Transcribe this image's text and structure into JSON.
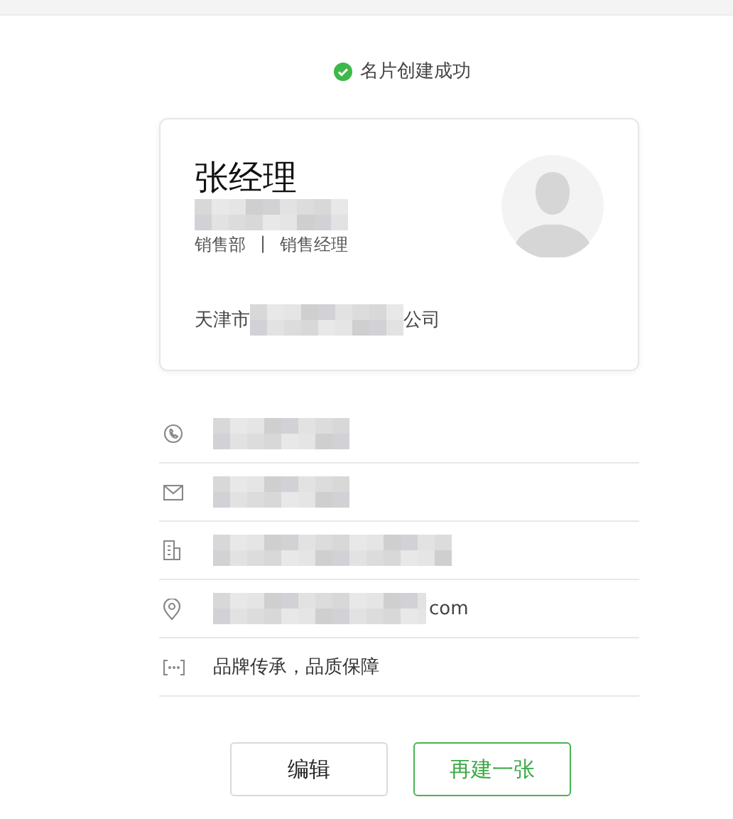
{
  "notice": {
    "text": "名片创建成功"
  },
  "card": {
    "name": "张经理",
    "name_line_redacted": true,
    "department": "销售部",
    "separator": "|",
    "title": "销售经理",
    "company_prefix": "天津市",
    "company_redacted": true,
    "company_suffix": "公司"
  },
  "rows": [
    {
      "kind": "phone",
      "redacted": true
    },
    {
      "kind": "email",
      "redacted": true
    },
    {
      "kind": "company",
      "redacted": true
    },
    {
      "kind": "address",
      "text": "com",
      "redacted": true
    },
    {
      "kind": "slogan",
      "text": "品牌传承，品质保障",
      "redacted": false
    }
  ],
  "buttons": [
    {
      "label": "编辑",
      "kind": "default"
    },
    {
      "label": "再建一张",
      "kind": "primary"
    }
  ]
}
